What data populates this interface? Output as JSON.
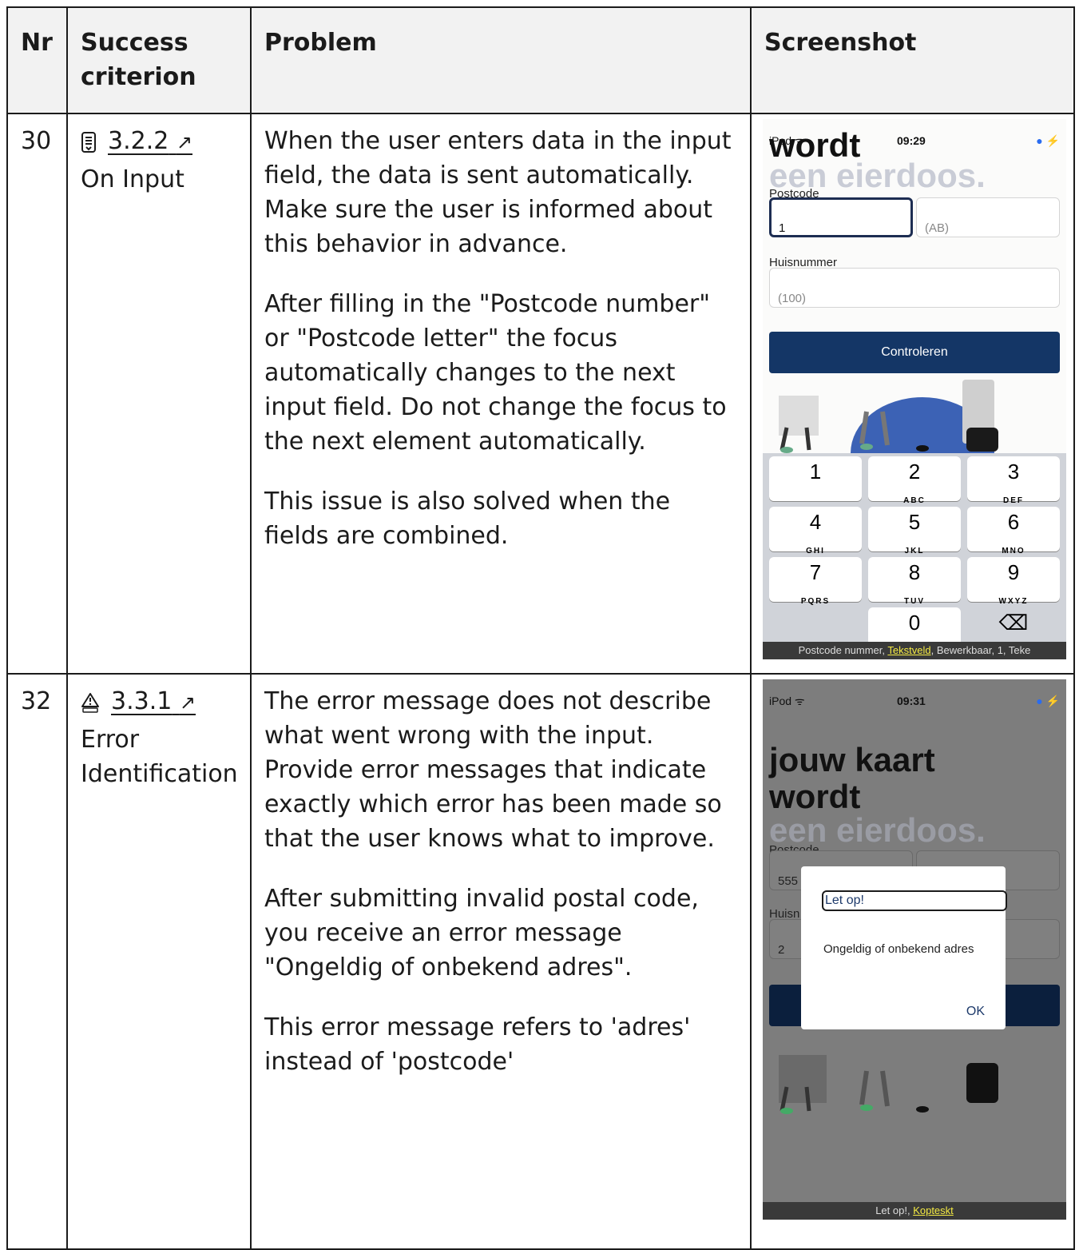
{
  "table": {
    "headers": [
      "Nr",
      "Success criterion",
      "Problem",
      "Screenshot"
    ],
    "rows": [
      {
        "nr": "30",
        "criterion_icon": "document-icon",
        "criterion_code": "3.2.2",
        "criterion_name": "On Input",
        "problem": [
          "When the user enters data in the input field, the data is sent automatically. Make sure the user is informed about this behavior in advance.",
          "After filling in the \"Postcode number\" or \"Postcode letter\" the focus automatically changes to the next input field. Do not change the focus to the next element automatically.",
          "This issue is also solved when the fields are combined."
        ],
        "screenshot": {
          "status_left": "iPod ᯤ",
          "status_time": "09:29",
          "status_right": "● ⚡",
          "heading": "wordt",
          "ghost_text": "een eierdoos.",
          "postcode_label": "Postcode",
          "postcode_number_value": "1",
          "postcode_letters_placeholder": "(AB)",
          "house_label": "Huisnummer",
          "house_placeholder": "(100)",
          "button_label": "Controleren",
          "keys": [
            {
              "digit": "1",
              "letters": ""
            },
            {
              "digit": "2",
              "letters": "ABC"
            },
            {
              "digit": "3",
              "letters": "DEF"
            },
            {
              "digit": "4",
              "letters": "GHI"
            },
            {
              "digit": "5",
              "letters": "JKL"
            },
            {
              "digit": "6",
              "letters": "MNO"
            },
            {
              "digit": "7",
              "letters": "PQRS"
            },
            {
              "digit": "8",
              "letters": "TUV"
            },
            {
              "digit": "9",
              "letters": "WXYZ"
            },
            {
              "digit": "0",
              "letters": ""
            },
            {
              "digit": "⌫",
              "letters": ""
            }
          ],
          "voiceover_pre": "Postcode nummer, ",
          "voiceover_highlight": "Tekstveld",
          "voiceover_post": ", Bewerkbaar, 1, Teke"
        }
      },
      {
        "nr": "32",
        "criterion_icon": "warning-icon",
        "criterion_code": "3.3.1",
        "criterion_name": "Error Identification",
        "problem": [
          "The error message does not describe what went wrong with the input. Provide error messages that indicate exactly which error has been made so that the user knows what to improve.",
          "After submitting invalid postal code, you receive an error message \"Ongeldig of onbekend adres\".",
          "This error message refers to 'adres' instead of 'postcode'"
        ],
        "screenshot": {
          "status_left": "iPod ᯤ",
          "status_time": "09:31",
          "status_right": "● ⚡",
          "heading_line1": "jouw kaart",
          "heading_line2": "wordt",
          "ghost_text": "een eierdoos.",
          "postcode_label": "Postcode",
          "postcode_value": "555",
          "house_label": "Huisn",
          "house_value": "2",
          "dialog_title": "Let op!",
          "dialog_message": "Ongeldig of onbekend adres",
          "dialog_ok": "OK",
          "voiceover_pre": "Let op!, ",
          "voiceover_highlight": "Kopteskt"
        }
      }
    ]
  },
  "colors": {
    "button": "#143666",
    "voiceover_highlight": "#f4ea43",
    "header_bg": "#f2f2f2"
  }
}
